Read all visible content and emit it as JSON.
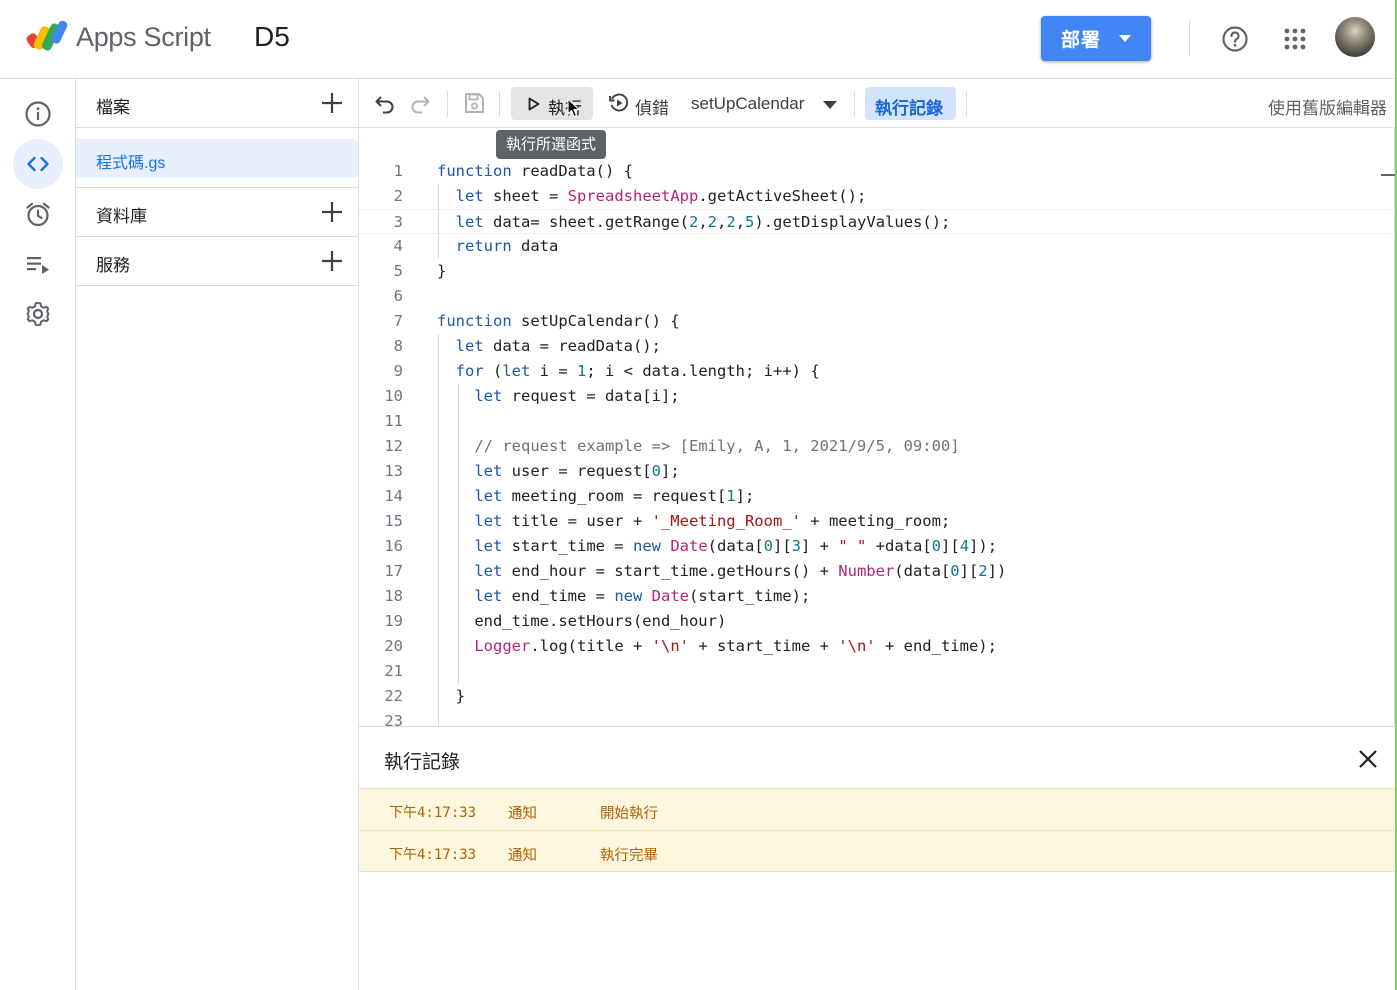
{
  "header": {
    "app_name": "Apps Script",
    "project_name": "D5",
    "deploy_label": "部署"
  },
  "rail": {
    "items": [
      "overview-icon",
      "editor-icon",
      "triggers-icon",
      "executions-icon",
      "settings-icon"
    ],
    "active": "editor-icon"
  },
  "files_panel": {
    "files_title": "檔案",
    "file_name": "程式碼.gs",
    "libraries_title": "資料庫",
    "services_title": "服務"
  },
  "toolbar": {
    "run_label": "執行",
    "debug_label": "偵錯",
    "function_name": "setUpCalendar",
    "log_label": "執行記錄",
    "legacy_label": "使用舊版編輯器",
    "tooltip": "執行所選函式"
  },
  "editor": {
    "lines": [
      [
        [
          "kw",
          "function"
        ],
        [
          "id",
          " readData() {"
        ]
      ],
      [
        [
          "id",
          "  "
        ],
        [
          "kw",
          "let"
        ],
        [
          "id",
          " sheet = "
        ],
        [
          "cls",
          "SpreadsheetApp"
        ],
        [
          "id",
          ".getActiveSheet();"
        ]
      ],
      [
        [
          "id",
          "  "
        ],
        [
          "kw",
          "let"
        ],
        [
          "id",
          " data= sheet.getRange("
        ],
        [
          "num",
          "2"
        ],
        [
          "id",
          ","
        ],
        [
          "num",
          "2"
        ],
        [
          "id",
          ","
        ],
        [
          "num",
          "2"
        ],
        [
          "id",
          ","
        ],
        [
          "num",
          "5"
        ],
        [
          "id",
          ").getDisplayValues();"
        ]
      ],
      [
        [
          "id",
          "  "
        ],
        [
          "kw",
          "return"
        ],
        [
          "id",
          " data"
        ]
      ],
      [
        [
          "id",
          "}"
        ]
      ],
      [],
      [
        [
          "kw",
          "function"
        ],
        [
          "id",
          " setUpCalendar() {"
        ]
      ],
      [
        [
          "id",
          "  "
        ],
        [
          "kw",
          "let"
        ],
        [
          "id",
          " data = readData();"
        ]
      ],
      [
        [
          "id",
          "  "
        ],
        [
          "kw",
          "for"
        ],
        [
          "id",
          " ("
        ],
        [
          "kw",
          "let"
        ],
        [
          "id",
          " i = "
        ],
        [
          "num",
          "1"
        ],
        [
          "id",
          "; i < data.length; i++) {"
        ]
      ],
      [
        [
          "id",
          "    "
        ],
        [
          "kw",
          "let"
        ],
        [
          "id",
          " request = data[i];"
        ]
      ],
      [],
      [
        [
          "id",
          "    "
        ],
        [
          "cmt",
          "// request example => [Emily, A, 1, 2021/9/5, 09:00]"
        ]
      ],
      [
        [
          "id",
          "    "
        ],
        [
          "kw",
          "let"
        ],
        [
          "id",
          " user = request["
        ],
        [
          "num",
          "0"
        ],
        [
          "id",
          "];"
        ]
      ],
      [
        [
          "id",
          "    "
        ],
        [
          "kw",
          "let"
        ],
        [
          "id",
          " meeting_room = request["
        ],
        [
          "num",
          "1"
        ],
        [
          "id",
          "];"
        ]
      ],
      [
        [
          "id",
          "    "
        ],
        [
          "kw",
          "let"
        ],
        [
          "id",
          " title = user + "
        ],
        [
          "str",
          "'_Meeting_Room_'"
        ],
        [
          "id",
          " + meeting_room;"
        ]
      ],
      [
        [
          "id",
          "    "
        ],
        [
          "kw",
          "let"
        ],
        [
          "id",
          " start_time = "
        ],
        [
          "kw",
          "new"
        ],
        [
          "id",
          " "
        ],
        [
          "cls",
          "Date"
        ],
        [
          "id",
          "(data["
        ],
        [
          "num",
          "0"
        ],
        [
          "id",
          "]["
        ],
        [
          "num",
          "3"
        ],
        [
          "id",
          "] + "
        ],
        [
          "str",
          "\" \""
        ],
        [
          "id",
          " +data["
        ],
        [
          "num",
          "0"
        ],
        [
          "id",
          "]["
        ],
        [
          "num",
          "4"
        ],
        [
          "id",
          "]);"
        ]
      ],
      [
        [
          "id",
          "    "
        ],
        [
          "kw",
          "let"
        ],
        [
          "id",
          " end_hour = start_time.getHours() + "
        ],
        [
          "cls",
          "Number"
        ],
        [
          "id",
          "(data["
        ],
        [
          "num",
          "0"
        ],
        [
          "id",
          "]["
        ],
        [
          "num",
          "2"
        ],
        [
          "id",
          "])"
        ]
      ],
      [
        [
          "id",
          "    "
        ],
        [
          "kw",
          "let"
        ],
        [
          "id",
          " end_time = "
        ],
        [
          "kw",
          "new"
        ],
        [
          "id",
          " "
        ],
        [
          "cls",
          "Date"
        ],
        [
          "id",
          "(start_time);"
        ]
      ],
      [
        [
          "id",
          "    end_time.setHours(end_hour)"
        ]
      ],
      [
        [
          "id",
          "    "
        ],
        [
          "cls",
          "Logger"
        ],
        [
          "id",
          ".log(title + "
        ],
        [
          "str",
          "'\\n'"
        ],
        [
          "id",
          " + start_time + "
        ],
        [
          "str",
          "'\\n'"
        ],
        [
          "id",
          " + end_time);"
        ]
      ],
      [],
      [
        [
          "id",
          "  }"
        ]
      ],
      []
    ],
    "current_line": 3
  },
  "log_panel": {
    "title": "執行記錄",
    "entries": [
      {
        "time": "下午4:17:33",
        "type": "通知",
        "message": "開始執行"
      },
      {
        "time": "下午4:17:33",
        "type": "通知",
        "message": "執行完畢"
      }
    ]
  },
  "colors": {
    "accent": "#1a73e8",
    "deploy": "#4285f4",
    "log_bg": "#fef7e0",
    "log_text": "#b06000"
  }
}
